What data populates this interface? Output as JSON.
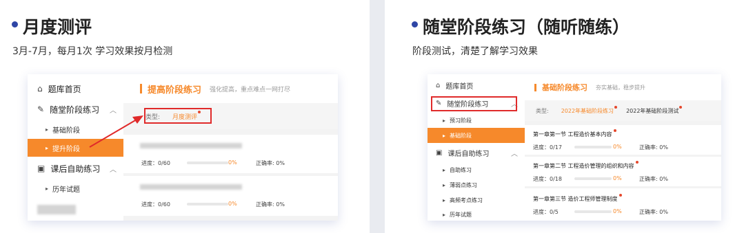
{
  "left": {
    "heading": "月度测评",
    "subtitle": "3月-7月，每月1次 学习效果按月检测",
    "sidebar": [
      {
        "label": "题库首页",
        "icon": "home-icon"
      },
      {
        "label": "随堂阶段练习",
        "icon": "pencil-icon"
      },
      {
        "label": "基础阶段"
      },
      {
        "label": "提升阶段"
      },
      {
        "label": "课后自助练习",
        "icon": "book-icon"
      },
      {
        "label": "历年试题"
      }
    ],
    "main_title": "提高阶段练习",
    "main_desc": "强化提高，重点难点一网打尽",
    "filter_label": "类型:",
    "filter_value": "月度测评",
    "rows": [
      {
        "progress": "进度：0/60",
        "pct": "0%",
        "accuracy": "正确率: 0%"
      },
      {
        "progress": "进度：0/60",
        "pct": "0%",
        "accuracy": "正确率: 0%"
      }
    ]
  },
  "right": {
    "heading": "随堂阶段练习（随听随练）",
    "subtitle": "阶段测试，清楚了解学习效果",
    "sidebar": [
      {
        "label": "题库首页",
        "icon": "home-icon"
      },
      {
        "label": "随堂阶段练习",
        "icon": "pencil-icon"
      },
      {
        "label": "预习阶段"
      },
      {
        "label": "基础阶段"
      },
      {
        "label": "课后自助练习",
        "icon": "book-icon"
      },
      {
        "label": "自助练习"
      },
      {
        "label": "薄弱点练习"
      },
      {
        "label": "高频考点练习"
      },
      {
        "label": "历年试题"
      }
    ],
    "main_title": "基础阶段练习",
    "main_desc": "夯实基础，稳步提升",
    "filter_label": "类型:",
    "filter_value_1": "2022年基础阶段练习",
    "filter_value_2": "2022年基础阶段测试",
    "rows": [
      {
        "title": "第一章第一节    工程造价基本内容",
        "progress": "进度：0/17",
        "pct": "0%",
        "accuracy": "正确率: 0%"
      },
      {
        "title": "第一章第二节    工程造价管理的组织和内容",
        "progress": "进度：0/18",
        "pct": "0%",
        "accuracy": "正确率: 0%"
      },
      {
        "title": "第一章第三节    造价工程师管理制度",
        "progress": "进度：0/5",
        "pct": "0%",
        "accuracy": "正确率: 0%"
      }
    ]
  },
  "colors": {
    "accent": "#f6892b",
    "highlight": "#e02a2a",
    "dot": "#2f46a6"
  }
}
